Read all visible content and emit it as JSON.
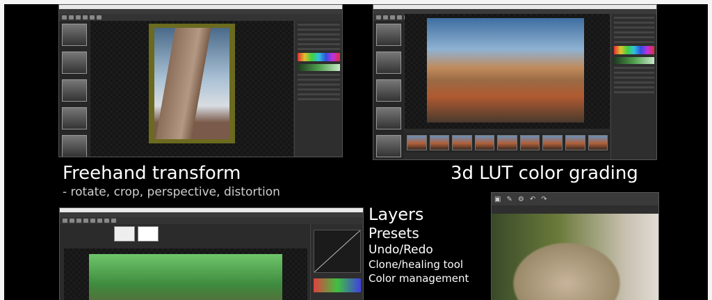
{
  "captions": {
    "freehand_title": "Freehand transform",
    "freehand_sub": "- rotate, crop, perspective, distortion",
    "lut_title": "3d LUT color grading"
  },
  "feature_list": [
    "Layers",
    "Presets",
    "Undo/Redo",
    "Clone/healing tool",
    "Color management"
  ],
  "colors": {
    "background": "#000000",
    "frame": "#f4f4f4",
    "ui_dark": "#2b2b2b",
    "accent_green": "#5aa050"
  },
  "icons": [
    "crop-icon",
    "brush-icon",
    "gear-icon",
    "undo-icon",
    "redo-icon"
  ]
}
